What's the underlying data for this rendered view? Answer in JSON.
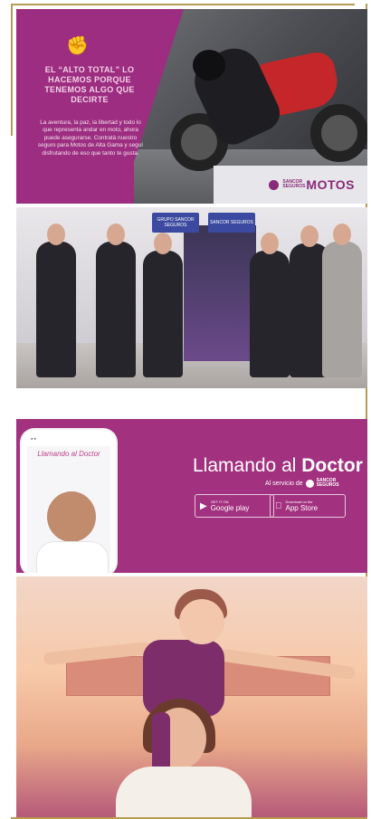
{
  "panel1": {
    "headline": "EL “ALTO TOTAL” LO HACEMOS PORQUE TENEMOS ALGO QUE DECIRTE",
    "body": "La aventura, la paz, la libertad y todo lo que representa andar en moto, ahora puede asegurarse. Contratá nuestro seguro para Motos de Alta Gama y seguí disfrutando de eso que tanto te gusta.",
    "brand_small": "SANCOR SEGUROS",
    "brand_big": "MOTOS"
  },
  "panel2": {
    "sign_left": "GRUPO SANCOR SEGUROS",
    "sign_right": "SANCOR SEGUROS"
  },
  "panel3": {
    "phone_app_title": "Llamando al Doctor",
    "title_regular": "Llamando al ",
    "title_bold": "Doctor",
    "subtitle": "Al servicio de",
    "subtitle_brand": "SANCOR SEGUROS",
    "google_small": "GET IT ON",
    "google_big": "Google play",
    "apple_small": "Download on the",
    "apple_big": "App Store"
  },
  "colors": {
    "magenta": "#9c2d80",
    "magenta_panel3": "#a2317f",
    "gold": "#b89b52",
    "bike_red": "#c4262a"
  }
}
